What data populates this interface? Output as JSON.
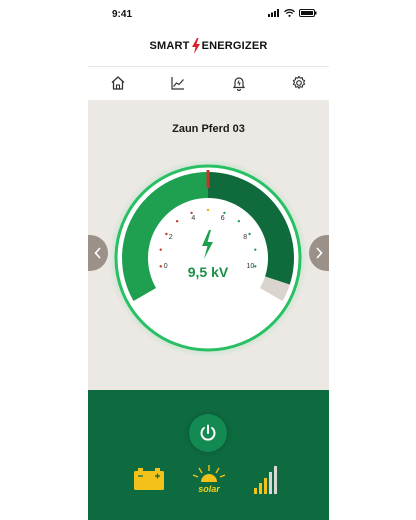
{
  "status": {
    "time": "9:41"
  },
  "brand": {
    "word1": "SMART",
    "word2": "ENERGIZER",
    "logo_icon": "lightning-bolt-icon",
    "accent": "#d8232a"
  },
  "nav": {
    "items": [
      "home-icon",
      "chart-icon",
      "alarm-bell-icon",
      "settings-gear-icon"
    ]
  },
  "device": {
    "name": "Zaun Pferd 03"
  },
  "gauge": {
    "value": 9.5,
    "value_label": "9,5 kV",
    "min": 0,
    "max": 10,
    "ticks": [
      "0",
      "2",
      "4",
      "6",
      "8",
      "10"
    ],
    "colors": {
      "fill": "#1fa050",
      "track": "#0f6a3c",
      "glow": "#2ecc71",
      "marker": "#c0392b"
    }
  },
  "bottom": {
    "power_icon": "power-icon",
    "battery_icon": "battery-icon",
    "solar_label": "solar",
    "signal_icon": "signal-strength-icon",
    "colors": {
      "bg": "#0e6b40",
      "yellow": "#f2c21b"
    }
  }
}
